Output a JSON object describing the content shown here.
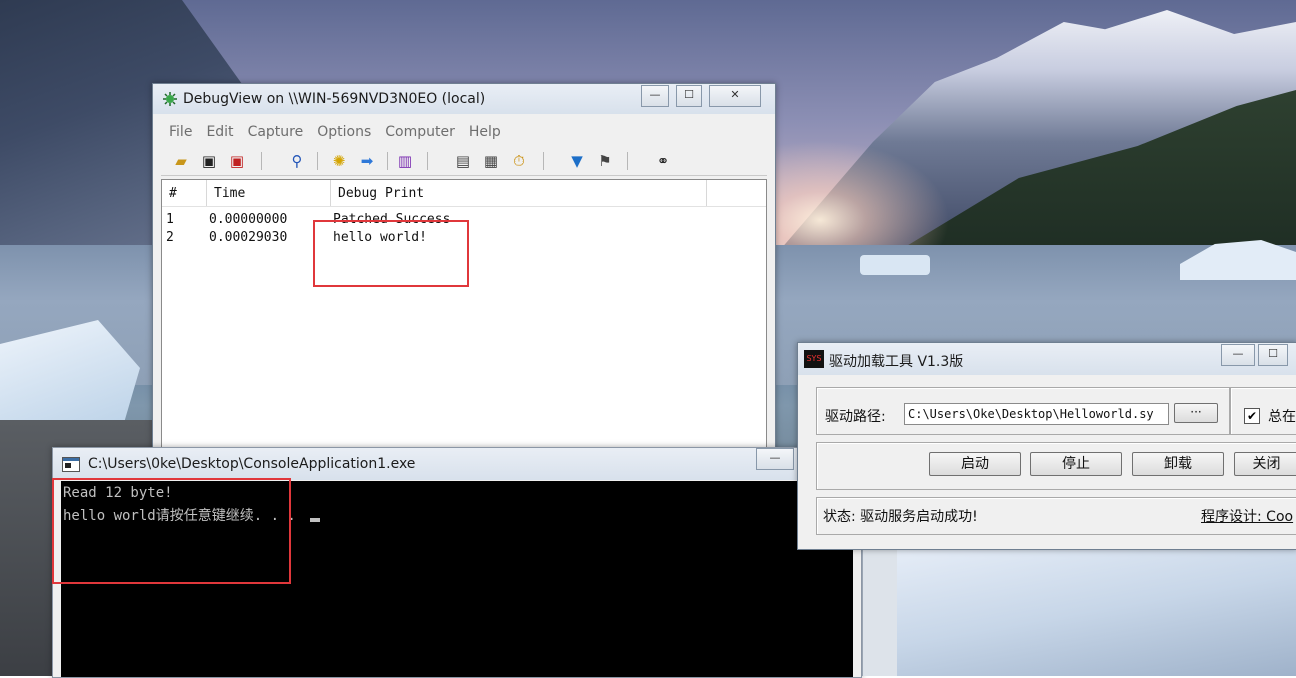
{
  "debugview": {
    "title": "DebugView on \\\\WIN-569NVD3N0EO (local)",
    "menu": [
      "File",
      "Edit",
      "Capture",
      "Options",
      "Computer",
      "Help"
    ],
    "columns": {
      "num": "#",
      "time": "Time",
      "print": "Debug Print"
    },
    "rows": [
      {
        "num": "1",
        "time": "0.00000000",
        "print": "Patched Success"
      },
      {
        "num": "2",
        "time": "0.00029030",
        "print": "hello world!"
      }
    ]
  },
  "console": {
    "title": "C:\\Users\\0ke\\Desktop\\ConsoleApplication1.exe",
    "lines": [
      "Read 12 byte!",
      "hello world请按任意键继续. . . "
    ]
  },
  "driver_tool": {
    "title": "驱动加载工具 V1.3版",
    "icon_text": "SYS",
    "path_label": "驱动路径:",
    "path_value": "C:\\Users\\Oke\\Desktop\\Helloworld.sy",
    "browse_label": "···",
    "always_label": "总在",
    "buttons": {
      "start": "启动",
      "stop": "停止",
      "uninstall": "卸载",
      "close": "关闭"
    },
    "status": "状态: 驱动服务启动成功!",
    "designer": "程序设计: Coo"
  },
  "window_controls": {
    "minimize": "—",
    "maximize": "☐",
    "close": "✕"
  },
  "colors": {
    "highlight_box": "#e0373b",
    "console_bg": "#000000",
    "console_text": "#c0c0c0"
  }
}
